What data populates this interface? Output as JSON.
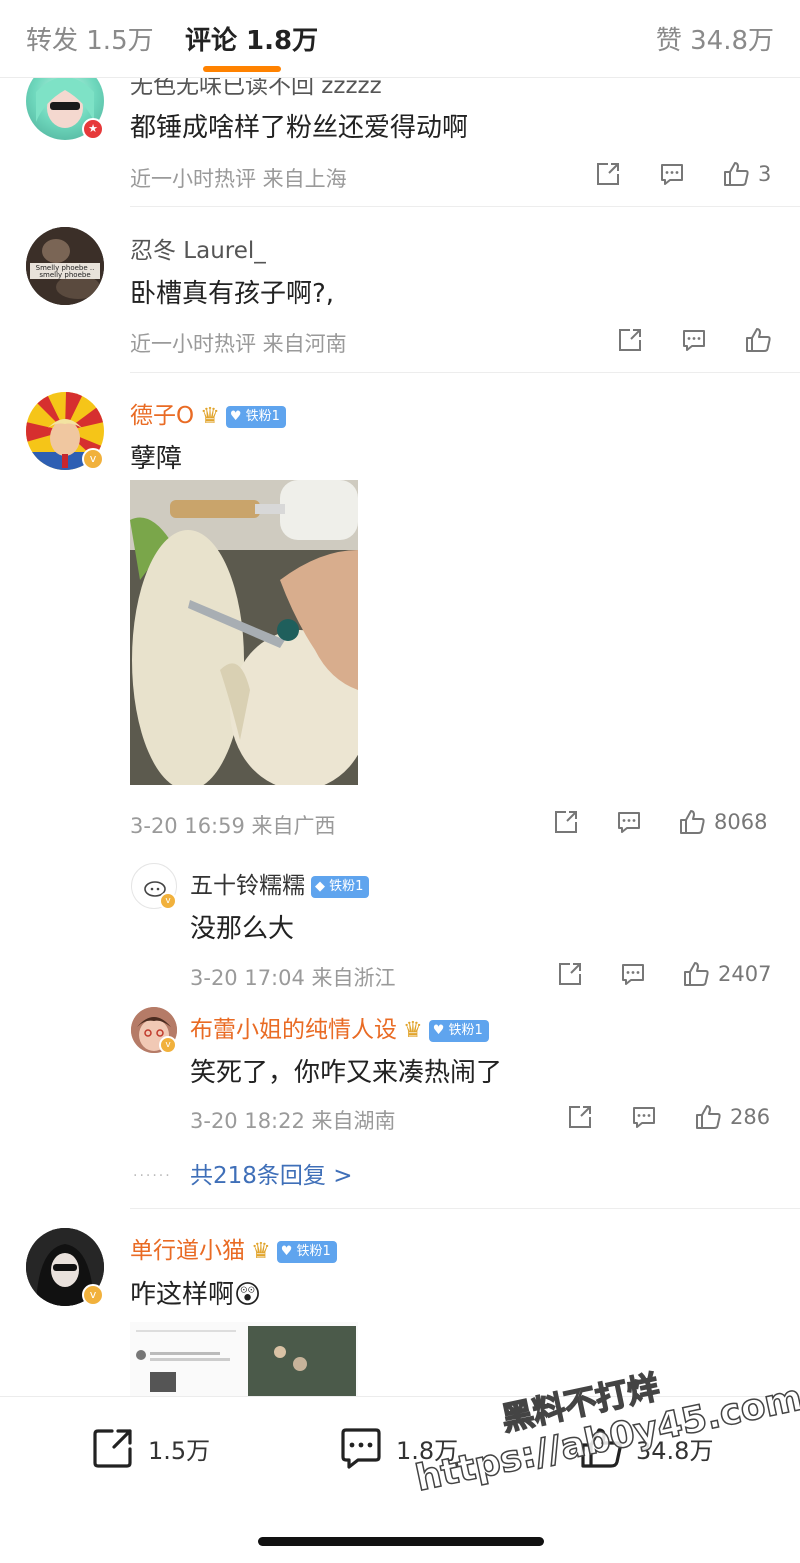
{
  "tabs": {
    "repost": "转发 1.5万",
    "comments": "评论 1.8万",
    "likes": "赞 34.8万"
  },
  "comments": [
    {
      "user": "无色无味已读不回 zzzzz",
      "text": "都锤成啥样了粉丝还爱得动啊",
      "meta": "近一小时热评 来自上海",
      "likes": "3"
    },
    {
      "user": "忍冬 Laurel_",
      "avatar_text": "Smelly phoebe .. smelly phoebe",
      "text": "卧槽真有孩子啊?,",
      "meta": "近一小时热评 来自河南",
      "likes": ""
    },
    {
      "user": "德子O",
      "fan_badge": "铁粉1",
      "text": "孽障",
      "meta": "3-20 16:59 来自广西",
      "likes": "8068",
      "replies": [
        {
          "user": "五十铃糯糯",
          "fan_badge": "铁粉1",
          "text": "没那么大",
          "meta": "3-20 17:04 来自浙江",
          "likes": "2407"
        },
        {
          "user": "布蕾小姐的纯情人设",
          "fan_badge": "铁粉1",
          "text": "笑死了，你咋又来凑热闹了",
          "meta": "3-20 18:22 来自湖南",
          "likes": "286"
        }
      ],
      "more_replies": "共218条回复 >"
    },
    {
      "user": "单行道小猫",
      "fan_badge": "铁粉1",
      "text": "咋这样啊😲"
    }
  ],
  "bottom_bar": {
    "repost": "1.5万",
    "comment": "1.8万",
    "like": "34.8万"
  },
  "watermark": {
    "line1": "黑料不打烊",
    "line2": "https://ab0y45.com"
  },
  "colors": {
    "accent": "#ff8200",
    "username_highlight": "#e96b24",
    "fan_badge": "#5fa4ee",
    "link": "#3f6fb8"
  }
}
